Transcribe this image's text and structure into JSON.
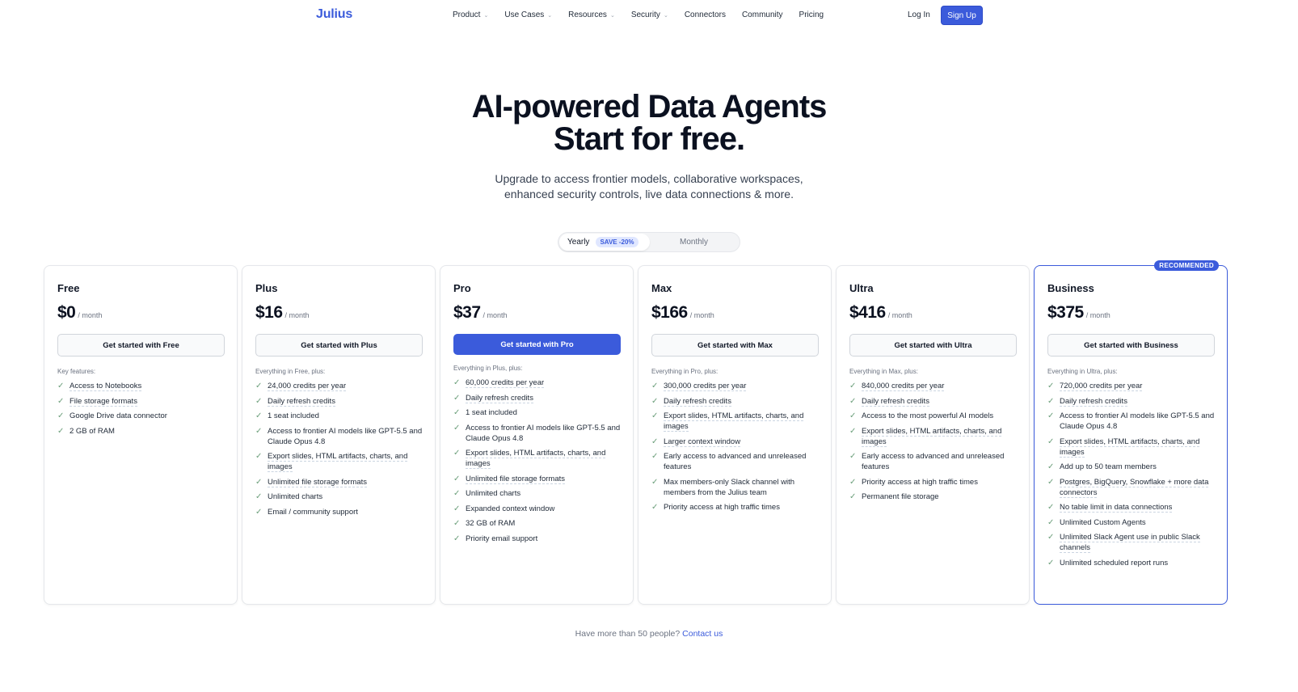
{
  "nav": {
    "logo": "Julius",
    "links": [
      {
        "label": "Product",
        "dropdown": true
      },
      {
        "label": "Use Cases",
        "dropdown": true
      },
      {
        "label": "Resources",
        "dropdown": true
      },
      {
        "label": "Security",
        "dropdown": true
      },
      {
        "label": "Connectors",
        "dropdown": false
      },
      {
        "label": "Community",
        "dropdown": false
      },
      {
        "label": "Pricing",
        "dropdown": false
      }
    ],
    "login": "Log In",
    "signup": "Sign Up"
  },
  "hero": {
    "title_line1": "AI-powered Data Agents",
    "title_line2": "Start for free.",
    "sub_line1": "Upgrade to access frontier models, collaborative workspaces,",
    "sub_line2": "enhanced security controls, live data connections & more."
  },
  "billing": {
    "yearly": "Yearly",
    "save_badge": "SAVE -20%",
    "monthly": "Monthly"
  },
  "colors": {
    "accent": "#3b5bdb",
    "check": "#6b9e7a"
  },
  "plans": [
    {
      "name": "Free",
      "price": "$0",
      "per": "/ month",
      "cta": "Get started with Free",
      "primary": false,
      "features_head": "Key features:",
      "features": [
        {
          "text": "Access to Notebooks",
          "dotted": true
        },
        {
          "text": "File storage formats",
          "dotted": true
        },
        {
          "text": "Google Drive data connector",
          "dotted": false
        },
        {
          "text": "2 GB of RAM",
          "dotted": false
        }
      ]
    },
    {
      "name": "Plus",
      "price": "$16",
      "per": "/ month",
      "cta": "Get started with Plus",
      "primary": false,
      "features_head": "Everything in Free, plus:",
      "features": [
        {
          "text": "24,000 credits per year",
          "dotted": true
        },
        {
          "text": "Daily refresh credits",
          "dotted": true
        },
        {
          "text": "1 seat included",
          "dotted": false
        },
        {
          "text": "Access to frontier AI models like GPT-5.5 and Claude Opus 4.8",
          "dotted": false
        },
        {
          "text": "Export slides, HTML artifacts, charts, and images",
          "dotted": true
        },
        {
          "text": "Unlimited file storage formats",
          "dotted": true
        },
        {
          "text": "Unlimited charts",
          "dotted": false
        },
        {
          "text": "Email / community support",
          "dotted": false
        }
      ]
    },
    {
      "name": "Pro",
      "price": "$37",
      "per": "/ month",
      "cta": "Get started with Pro",
      "primary": true,
      "features_head": "Everything in Plus, plus:",
      "features": [
        {
          "text": "60,000 credits per year",
          "dotted": true
        },
        {
          "text": "Daily refresh credits",
          "dotted": true
        },
        {
          "text": "1 seat included",
          "dotted": false
        },
        {
          "text": "Access to frontier AI models like GPT-5.5 and Claude Opus 4.8",
          "dotted": false
        },
        {
          "text": "Export slides, HTML artifacts, charts, and images",
          "dotted": true
        },
        {
          "text": "Unlimited file storage formats",
          "dotted": true
        },
        {
          "text": "Unlimited charts",
          "dotted": false
        },
        {
          "text": "Expanded context window",
          "dotted": false
        },
        {
          "text": "32 GB of RAM",
          "dotted": false
        },
        {
          "text": "Priority email support",
          "dotted": false
        }
      ]
    },
    {
      "name": "Max",
      "price": "$166",
      "per": "/ month",
      "cta": "Get started with Max",
      "primary": false,
      "features_head": "Everything in Pro, plus:",
      "features": [
        {
          "text": "300,000 credits per year",
          "dotted": true
        },
        {
          "text": "Daily refresh credits",
          "dotted": true
        },
        {
          "text": "Export slides, HTML artifacts, charts, and images",
          "dotted": true
        },
        {
          "text": "Larger context window",
          "dotted": true
        },
        {
          "text": "Early access to advanced and unreleased features",
          "dotted": false
        },
        {
          "text": "Max members-only Slack channel with members from the Julius team",
          "dotted": false
        },
        {
          "text": "Priority access at high traffic times",
          "dotted": false
        }
      ]
    },
    {
      "name": "Ultra",
      "price": "$416",
      "per": "/ month",
      "cta": "Get started with Ultra",
      "primary": false,
      "features_head": "Everything in Max, plus:",
      "features": [
        {
          "text": "840,000 credits per year",
          "dotted": true
        },
        {
          "text": "Daily refresh credits",
          "dotted": true
        },
        {
          "text": "Access to the most powerful AI models",
          "dotted": false
        },
        {
          "text": "Export slides, HTML artifacts, charts, and images",
          "dotted": true
        },
        {
          "text": "Early access to advanced and unreleased features",
          "dotted": false
        },
        {
          "text": "Priority access at high traffic times",
          "dotted": false
        },
        {
          "text": "Permanent file storage",
          "dotted": false
        }
      ]
    },
    {
      "name": "Business",
      "price": "$375",
      "per": "/ month",
      "cta": "Get started with Business",
      "primary": false,
      "recommended": "RECOMMENDED",
      "features_head": "Everything in Ultra, plus:",
      "features": [
        {
          "text": "720,000 credits per year",
          "dotted": true
        },
        {
          "text": "Daily refresh credits",
          "dotted": true
        },
        {
          "text": "Access to frontier AI models like GPT-5.5 and Claude Opus 4.8",
          "dotted": false
        },
        {
          "text": "Export slides, HTML artifacts, charts, and images",
          "dotted": true
        },
        {
          "text": "Add up to 50 team members",
          "dotted": false
        },
        {
          "text": "Postgres, BigQuery, Snowflake + more data connectors",
          "dotted": true
        },
        {
          "text": "No table limit in data connections",
          "dotted": true
        },
        {
          "text": "Unlimited Custom Agents",
          "dotted": false
        },
        {
          "text": "Unlimited Slack Agent use in public Slack channels",
          "dotted": true
        },
        {
          "text": "Unlimited scheduled report runs",
          "dotted": false
        }
      ]
    }
  ],
  "footer": {
    "question": "Have more than 50 people?",
    "contact": "Contact us"
  }
}
